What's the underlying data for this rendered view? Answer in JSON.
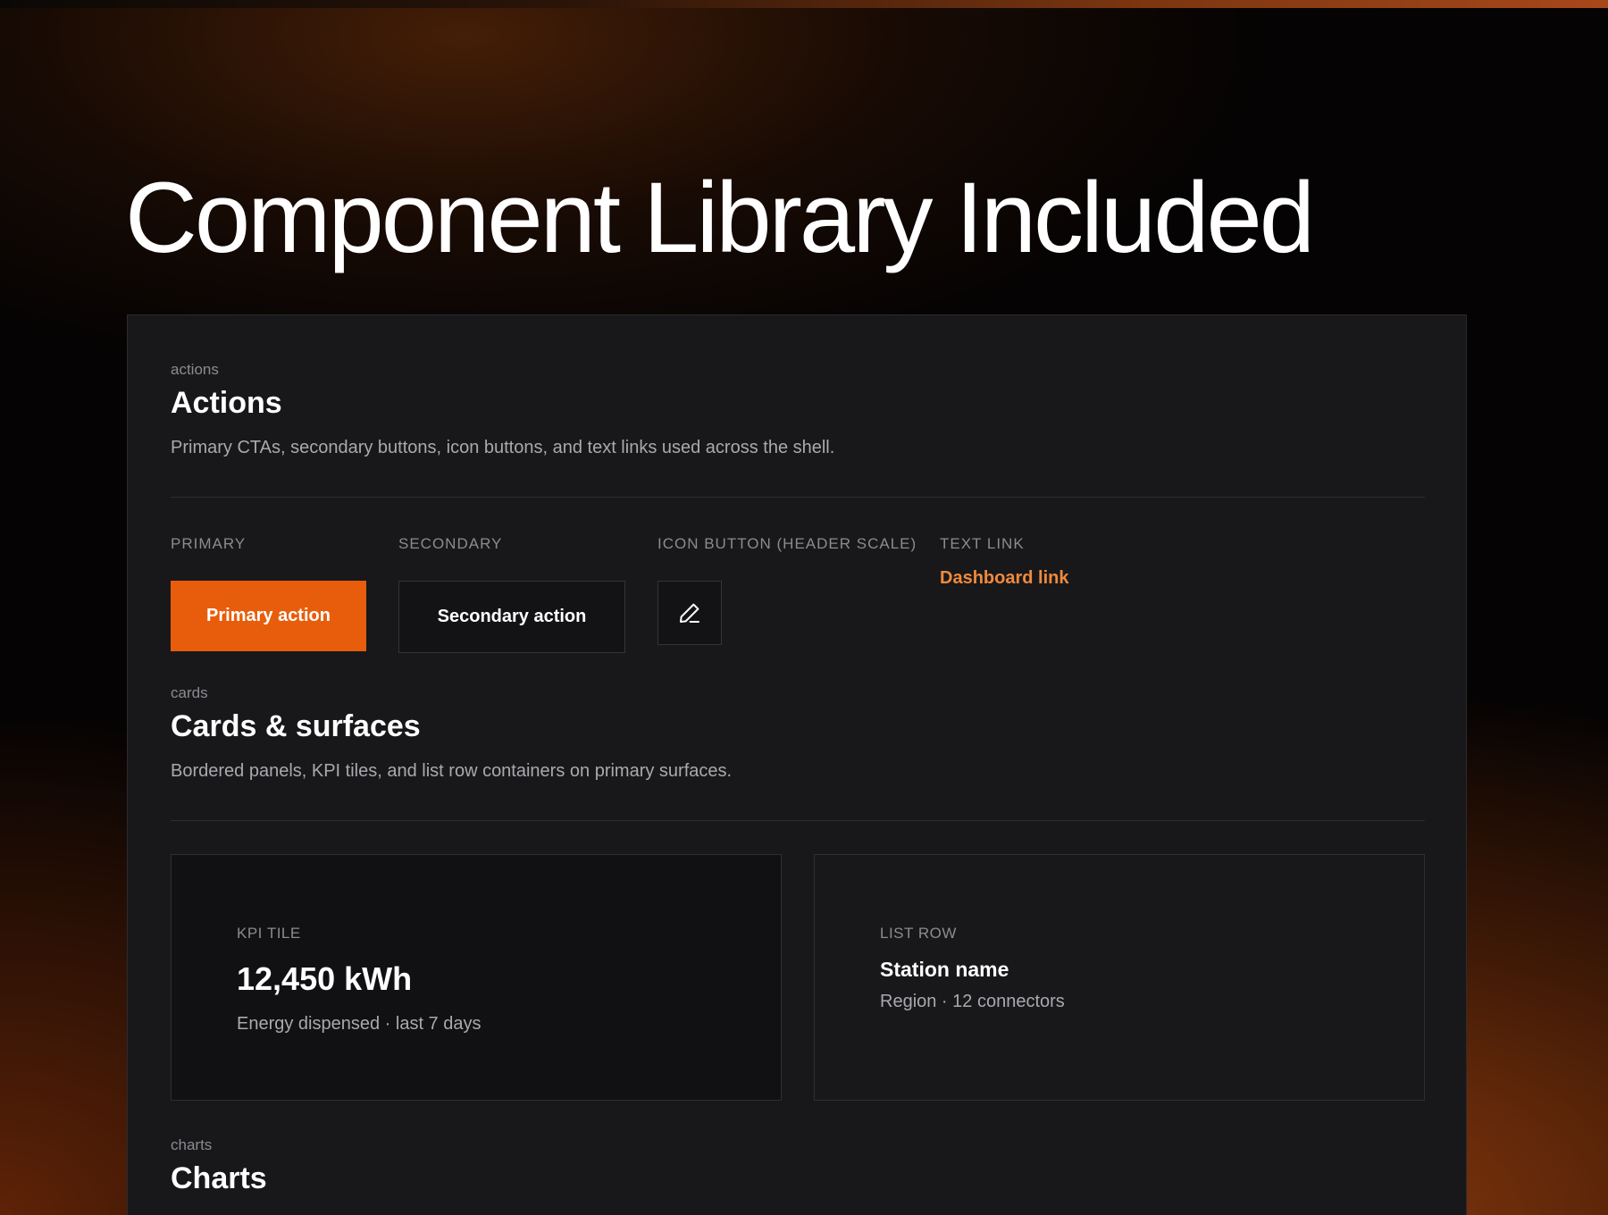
{
  "hero": {
    "title": "Component Library Included"
  },
  "actions_section": {
    "eyebrow": "actions",
    "title": "Actions",
    "description": "Primary CTAs, secondary buttons, icon buttons, and text links used across the shell.",
    "columns": {
      "primary_label": "PRIMARY",
      "secondary_label": "SECONDARY",
      "icon_label": "ICON BUTTON (HEADER SCALE)",
      "link_label": "TEXT LINK"
    },
    "primary_button": "Primary action",
    "secondary_button": "Secondary action",
    "icon_button_icon": "edit-pencil-icon",
    "text_link": "Dashboard link"
  },
  "cards_section": {
    "eyebrow": "cards",
    "title": "Cards & surfaces",
    "description": "Bordered panels, KPI tiles, and list row containers on primary surfaces.",
    "kpi_tile": {
      "label": "KPI TILE",
      "value": "12,450 kWh",
      "subtext": "Energy dispensed · last 7 days"
    },
    "list_row": {
      "label": "LIST ROW",
      "title": "Station name",
      "subtext": "Region · 12 connectors"
    }
  },
  "charts_section": {
    "eyebrow": "charts",
    "title": "Charts"
  },
  "colors": {
    "accent": "#e85d0c",
    "link": "#f08a3c",
    "panel": "#18181b",
    "kpi_surface": "#111113"
  }
}
